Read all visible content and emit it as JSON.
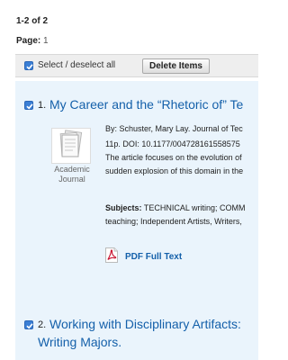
{
  "results_count": "1-2 of 2",
  "pagination": {
    "label": "Page:",
    "current": "1"
  },
  "toolbar": {
    "select_label": "Select / deselect all",
    "delete_label": "Delete Items"
  },
  "results": [
    {
      "number": "1.",
      "title": "My Career and the “Rhetoric of” Te",
      "thumb_label_line1": "Academic",
      "thumb_label_line2": "Journal",
      "byline": "By: Schuster, Mary Lay. Journal of Tec",
      "ids": "11p. DOI: 10.1177/004728161558575",
      "abstract_line1": "The article focuses on the evolution of",
      "abstract_line2": "sudden explosion of this domain in the",
      "subjects_label": "Subjects:",
      "subjects_line1": "TECHNICAL writing; COMM",
      "subjects_line2": "teaching; Independent Artists, Writers,",
      "pdf_label": "PDF Full Text"
    },
    {
      "number": "2.",
      "title_line1": "Working with Disciplinary Artifacts:",
      "title_line2": "Writing Majors."
    }
  ],
  "colors": {
    "accent_link": "#1460aa",
    "result_bg": "#eaf4fc",
    "checkbox": "#3b7fd5",
    "pdf_red": "#c8102e"
  },
  "icons": {
    "checkbox": "checkbox-checked-icon",
    "thumbnail": "academic-journal-icon",
    "pdf": "pdf-icon"
  }
}
